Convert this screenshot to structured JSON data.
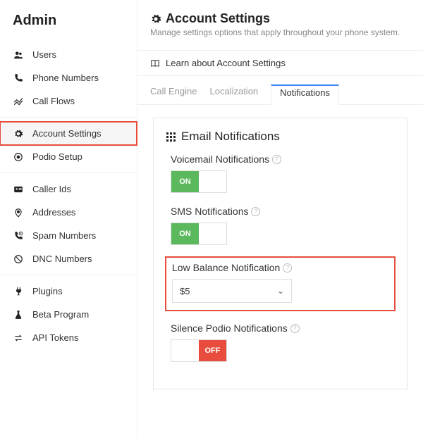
{
  "sidebar": {
    "title": "Admin",
    "groups": [
      {
        "items": [
          {
            "id": "users",
            "label": "Users"
          },
          {
            "id": "phone-numbers",
            "label": "Phone Numbers"
          },
          {
            "id": "call-flows",
            "label": "Call Flows"
          }
        ]
      },
      {
        "items": [
          {
            "id": "account-settings",
            "label": "Account Settings",
            "active": true
          },
          {
            "id": "podio-setup",
            "label": "Podio Setup"
          }
        ]
      },
      {
        "items": [
          {
            "id": "caller-ids",
            "label": "Caller Ids"
          },
          {
            "id": "addresses",
            "label": "Addresses"
          },
          {
            "id": "spam-numbers",
            "label": "Spam Numbers"
          },
          {
            "id": "dnc-numbers",
            "label": "DNC Numbers"
          }
        ]
      },
      {
        "items": [
          {
            "id": "plugins",
            "label": "Plugins"
          },
          {
            "id": "beta-program",
            "label": "Beta Program"
          },
          {
            "id": "api-tokens",
            "label": "API Tokens"
          }
        ]
      }
    ]
  },
  "page": {
    "title": "Account Settings",
    "subtitle": "Manage settings options that apply throughout your phone system.",
    "learn_label": "Learn about Account Settings"
  },
  "tabs": {
    "items": [
      {
        "id": "call-engine",
        "label": "Call Engine"
      },
      {
        "id": "localization",
        "label": "Localization"
      },
      {
        "id": "notifications",
        "label": "Notifications",
        "active": true
      }
    ]
  },
  "card": {
    "title": "Email Notifications",
    "settings": {
      "voicemail": {
        "label": "Voicemail Notifications",
        "state": "on",
        "on_text": "ON"
      },
      "sms": {
        "label": "SMS Notifications",
        "state": "on",
        "on_text": "ON"
      },
      "low_balance": {
        "label": "Low Balance Notification",
        "value": "$5"
      },
      "silence_podio": {
        "label": "Silence Podio Notifications",
        "state": "off",
        "off_text": "OFF"
      }
    }
  }
}
